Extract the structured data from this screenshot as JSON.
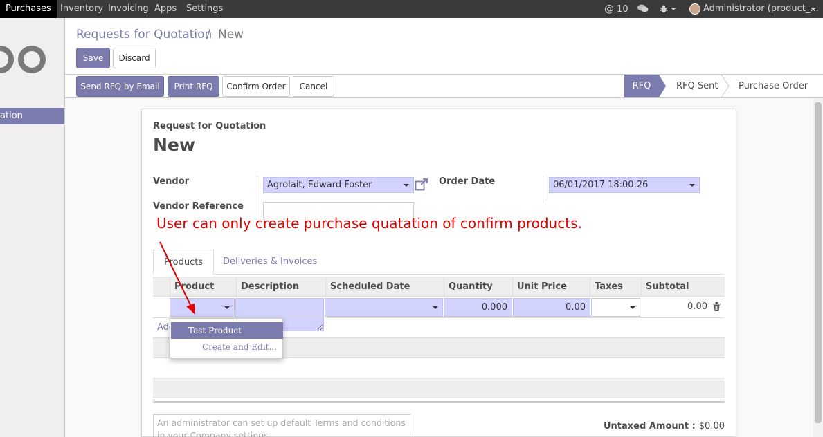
{
  "navbar": {
    "apps": [
      "Purchases",
      "Inventory",
      "Invoicing",
      "Apps",
      "Settings"
    ],
    "mentions_count": "10",
    "user_name": "Administrator (product_..."
  },
  "sidebar": {
    "active_label": "ation"
  },
  "breadcrumb": {
    "parent": "Requests for Quotation",
    "separator": "/",
    "current": "New"
  },
  "buttons": {
    "save": "Save",
    "discard": "Discard",
    "send_rfq": "Send RFQ by Email",
    "print_rfq": "Print RFQ",
    "confirm": "Confirm Order",
    "cancel": "Cancel"
  },
  "statusbar": {
    "stages": [
      "RFQ",
      "RFQ Sent",
      "Purchase Order"
    ],
    "active": "RFQ"
  },
  "form": {
    "doc_type": "Request for Quotation",
    "doc_name": "New",
    "vendor_label": "Vendor",
    "vendor_value": "Agrolait, Edward Foster",
    "vendor_ref_label": "Vendor Reference",
    "vendor_ref_value": "",
    "order_date_label": "Order Date",
    "order_date_value": "06/01/2017 18:00:26"
  },
  "annotation": "User can only create purchase quatation of confirm products.",
  "tabs": [
    "Products",
    "Deliveries & Invoices"
  ],
  "table": {
    "columns": [
      "Product",
      "Description",
      "Scheduled Date",
      "Quantity",
      "Unit Price",
      "Taxes",
      "Subtotal"
    ],
    "row": {
      "quantity": "0.000",
      "unit_price": "0.00",
      "subtotal": "0.00"
    },
    "add_item_partial": "Add"
  },
  "product_dropdown": {
    "options": [
      "Test Product",
      "Create and Edit..."
    ]
  },
  "footer": {
    "terms_placeholder": "An administrator can set up default Terms and conditions in your Company settings.",
    "untaxed_label": "Untaxed Amount :",
    "untaxed_value": "$0.00"
  },
  "colors": {
    "brand": "#7c7bad",
    "required_field": "#d2d2ff",
    "annotation": "#e00000"
  }
}
